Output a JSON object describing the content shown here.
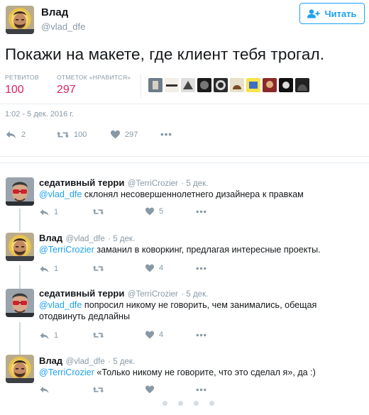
{
  "main_tweet": {
    "name": "Влад",
    "handle": "@vlad_dfe",
    "follow_label": "Читать",
    "text": "Покажи на макете, где клиент тебя трогал.",
    "retweets_label": "РЕТВИТОВ",
    "retweets_value": "100",
    "likes_label": "ОТМЕТОК «НРАВИТСЯ»",
    "likes_value": "297",
    "timestamp": "1:02 - 5 дек. 2016 г.",
    "actions": {
      "reply": "2",
      "retweet": "100",
      "like": "297"
    }
  },
  "replies": [
    {
      "name": "седативный терри",
      "handle": "@TerriCrozier",
      "date": "5 дек.",
      "mention": "@vlad_dfe",
      "text_line1": " склонял несовершеннолетнего дизайнера к правкам",
      "text_line2": "",
      "reply_count": "1",
      "retweet_count": "",
      "like_count": "5",
      "avatar": "man-red-glasses"
    },
    {
      "name": "Влад",
      "handle": "@vlad_dfe",
      "date": "5 дек.",
      "mention": "@TerriCrozier",
      "text_line1": " заманил в коворкинг, предлагая интересные проекты.",
      "text_line2": "",
      "reply_count": "1",
      "retweet_count": "",
      "like_count": "4",
      "avatar": "man-beard-icon"
    },
    {
      "name": "седативный терри",
      "handle": "@TerriCrozier",
      "date": "5 дек.",
      "mention": "@vlad_dfe",
      "text_line1": " попросил никому не говорить, чем занимались, обещая",
      "text_line2": "отодвинуть дедлайны",
      "reply_count": "1",
      "retweet_count": "",
      "like_count": "4",
      "avatar": "man-red-glasses"
    },
    {
      "name": "Влад",
      "handle": "@vlad_dfe",
      "date": "5 дек.",
      "mention": "@TerriCrozier",
      "text_line1": " «Только никому не говорите, что это сделал я», да :)",
      "text_line2": "",
      "reply_count": "",
      "retweet_count": "",
      "like_count": "",
      "avatar": "man-beard-icon"
    }
  ],
  "colors": {
    "accent": "#1da1f2",
    "like": "#e0245e",
    "muted": "#8899a6",
    "divider": "#e6ecf0"
  }
}
